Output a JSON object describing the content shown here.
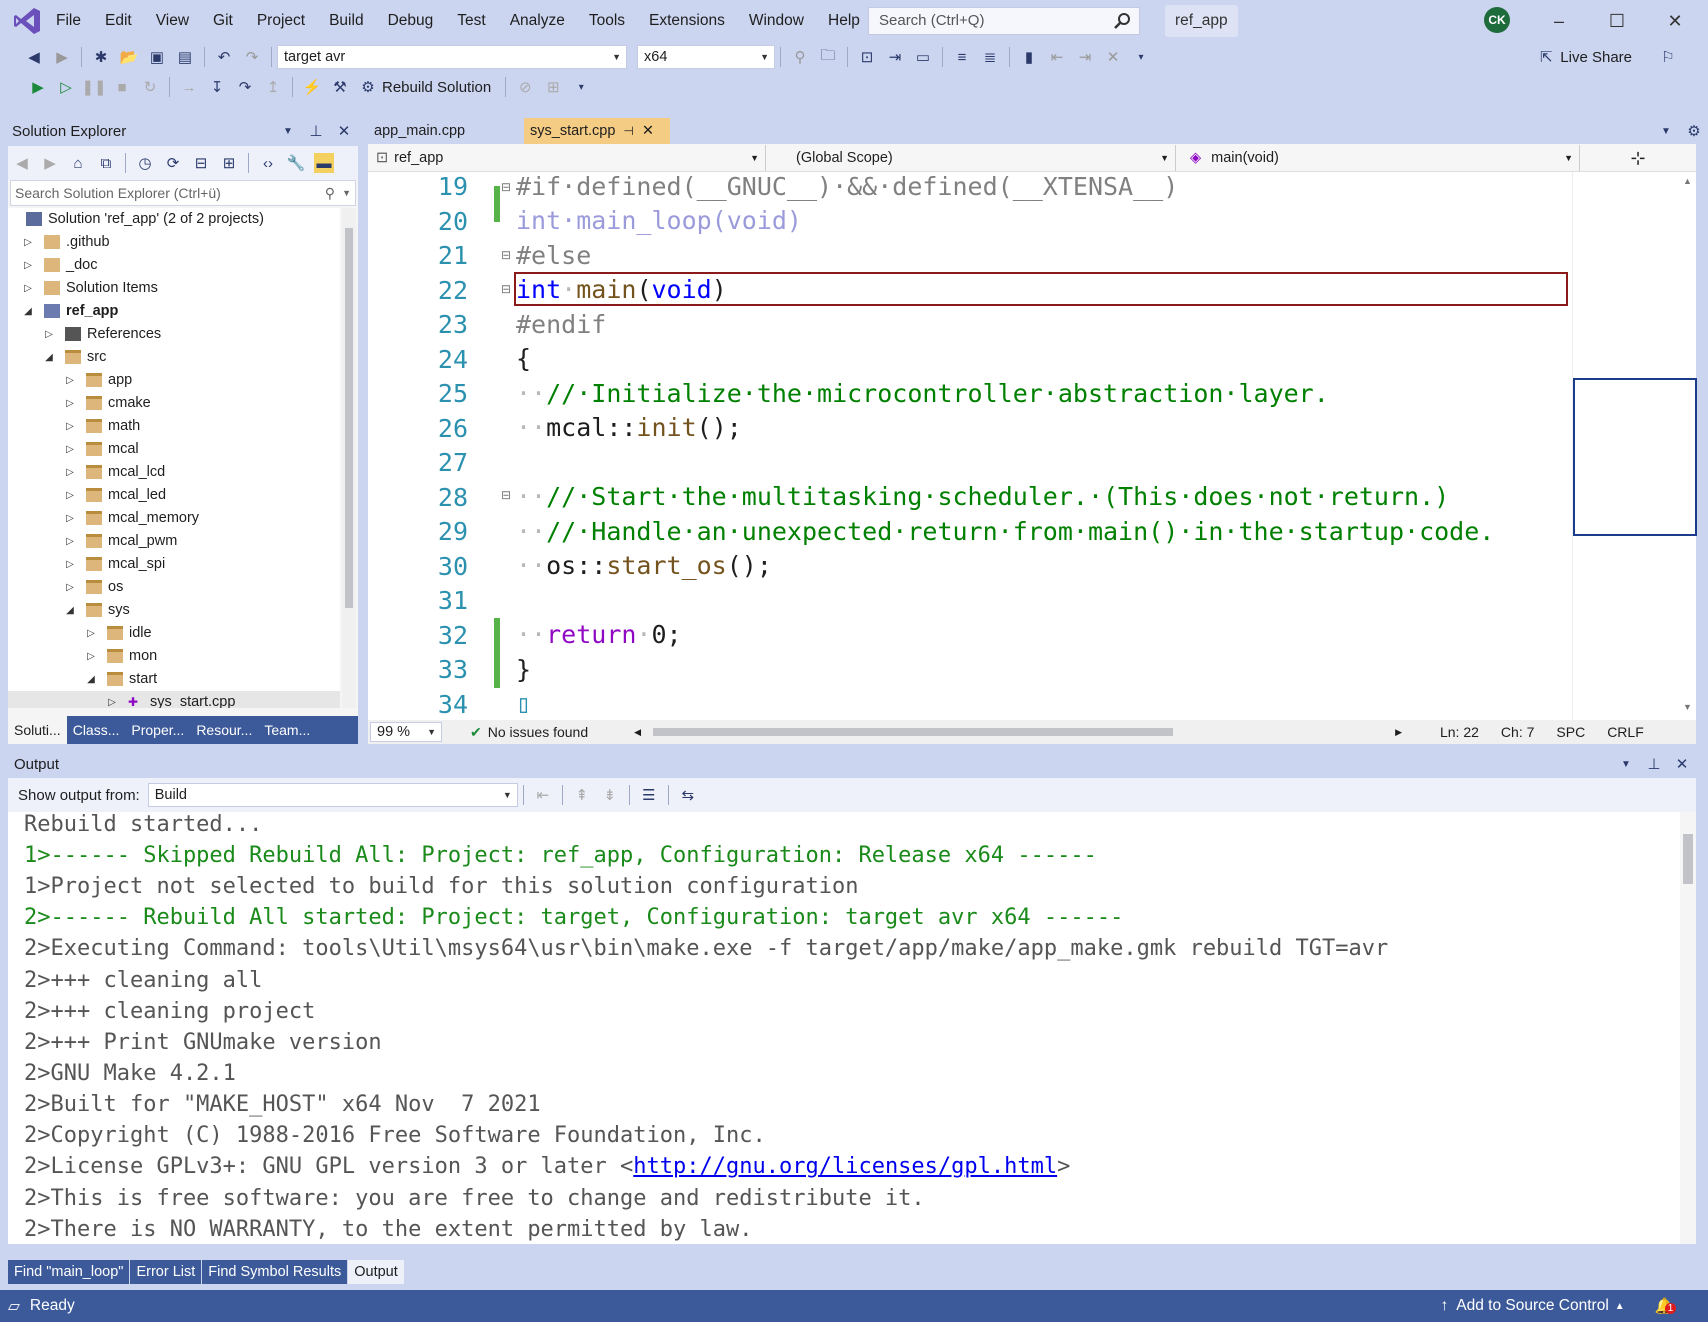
{
  "menu": [
    "File",
    "Edit",
    "View",
    "Git",
    "Project",
    "Build",
    "Debug",
    "Test",
    "Analyze",
    "Tools",
    "Extensions",
    "Window",
    "Help"
  ],
  "search": {
    "placeholder": "Search (Ctrl+Q)"
  },
  "project_name": "ref_app",
  "avatar": "CK",
  "toolbar": {
    "config": "target avr",
    "platform": "x64",
    "live_share": "Live Share",
    "rebuild": "Rebuild Solution"
  },
  "solution_explorer": {
    "title": "Solution Explorer",
    "search_placeholder": "Search Solution Explorer (Ctrl+ü)",
    "tree": [
      {
        "label": "Solution 'ref_app' (2 of 2 projects)",
        "depth": 0,
        "exp": ""
      },
      {
        "label": ".github",
        "depth": 0,
        "exp": "▷",
        "icon": "folder"
      },
      {
        "label": "_doc",
        "depth": 0,
        "exp": "▷",
        "icon": "folder"
      },
      {
        "label": "Solution Items",
        "depth": 0,
        "exp": "▷",
        "icon": "folder"
      },
      {
        "label": "ref_app",
        "depth": 0,
        "exp": "◢",
        "icon": "project",
        "bold": true
      },
      {
        "label": "References",
        "depth": 1,
        "exp": "▷",
        "icon": "ref"
      },
      {
        "label": "src",
        "depth": 1,
        "exp": "◢",
        "icon": "filter"
      },
      {
        "label": "app",
        "depth": 2,
        "exp": "▷",
        "icon": "filter"
      },
      {
        "label": "cmake",
        "depth": 2,
        "exp": "▷",
        "icon": "filter"
      },
      {
        "label": "math",
        "depth": 2,
        "exp": "▷",
        "icon": "filter"
      },
      {
        "label": "mcal",
        "depth": 2,
        "exp": "▷",
        "icon": "filter"
      },
      {
        "label": "mcal_lcd",
        "depth": 2,
        "exp": "▷",
        "icon": "filter"
      },
      {
        "label": "mcal_led",
        "depth": 2,
        "exp": "▷",
        "icon": "filter"
      },
      {
        "label": "mcal_memory",
        "depth": 2,
        "exp": "▷",
        "icon": "filter"
      },
      {
        "label": "mcal_pwm",
        "depth": 2,
        "exp": "▷",
        "icon": "filter"
      },
      {
        "label": "mcal_spi",
        "depth": 2,
        "exp": "▷",
        "icon": "filter"
      },
      {
        "label": "os",
        "depth": 2,
        "exp": "▷",
        "icon": "filter"
      },
      {
        "label": "sys",
        "depth": 2,
        "exp": "◢",
        "icon": "filter"
      },
      {
        "label": "idle",
        "depth": 3,
        "exp": "▷",
        "icon": "filter"
      },
      {
        "label": "mon",
        "depth": 3,
        "exp": "▷",
        "icon": "filter"
      },
      {
        "label": "start",
        "depth": 3,
        "exp": "◢",
        "icon": "filter"
      },
      {
        "label": "sys_start.cpp",
        "depth": 4,
        "exp": "▷",
        "icon": "cpp"
      }
    ],
    "bottom_tabs": [
      "Soluti...",
      "Class...",
      "Proper...",
      "Resour...",
      "Team..."
    ]
  },
  "editor": {
    "tabs": [
      "app_main.cpp",
      "sys_start.cpp"
    ],
    "nav": {
      "project": "ref_app",
      "scope": "(Global Scope)",
      "member": "main(void)"
    },
    "line_numbers": [
      "19",
      "20",
      "21",
      "22",
      "23",
      "24",
      "25",
      "26",
      "27",
      "28",
      "29",
      "30",
      "31",
      "32",
      "33",
      "34"
    ],
    "zoom": "99 %",
    "issues": "No issues found",
    "ln": "Ln: 22",
    "ch": "Ch: 7",
    "spc": "SPC",
    "eol": "CRLF"
  },
  "output": {
    "title": "Output",
    "show_from_label": "Show output from:",
    "source": "Build",
    "lines": [
      "Rebuild started...",
      "1>------ Skipped Rebuild All: Project: ref_app, Configuration: Release x64 ------",
      "1>Project not selected to build for this solution configuration",
      "2>------ Rebuild All started: Project: target, Configuration: target avr x64 ------",
      "2>Executing Command: tools\\Util\\msys64\\usr\\bin\\make.exe -f target/app/make/app_make.gmk rebuild TGT=avr",
      "2>+++ cleaning all",
      "2>+++ cleaning project",
      "2>+++ Print GNUmake version",
      "2>GNU Make 4.2.1",
      "2>Built for \"MAKE_HOST\" x64 Nov  7 2021",
      "2>Copyright (C) 1988-2016 Free Software Foundation, Inc.",
      "2>License GPLv3+: GNU GPL version 3 or later <",
      "2>This is free software: you are free to change and redistribute it.",
      "2>There is NO WARRANTY, to the extent permitted by law."
    ],
    "license_link": "http://gnu.org/licenses/gpl.html",
    "license_suffix": ">",
    "bottom_tabs": [
      "Find \"main_loop\"",
      "Error List",
      "Find Symbol Results",
      "Output"
    ]
  },
  "status": {
    "ready": "Ready",
    "source_control": "Add to Source Control",
    "notif_count": "1"
  },
  "colors": {
    "accent": "#3c5a9a",
    "chrome": "#ccd5f0",
    "keyword": "#0000ff",
    "comment": "#008000"
  }
}
